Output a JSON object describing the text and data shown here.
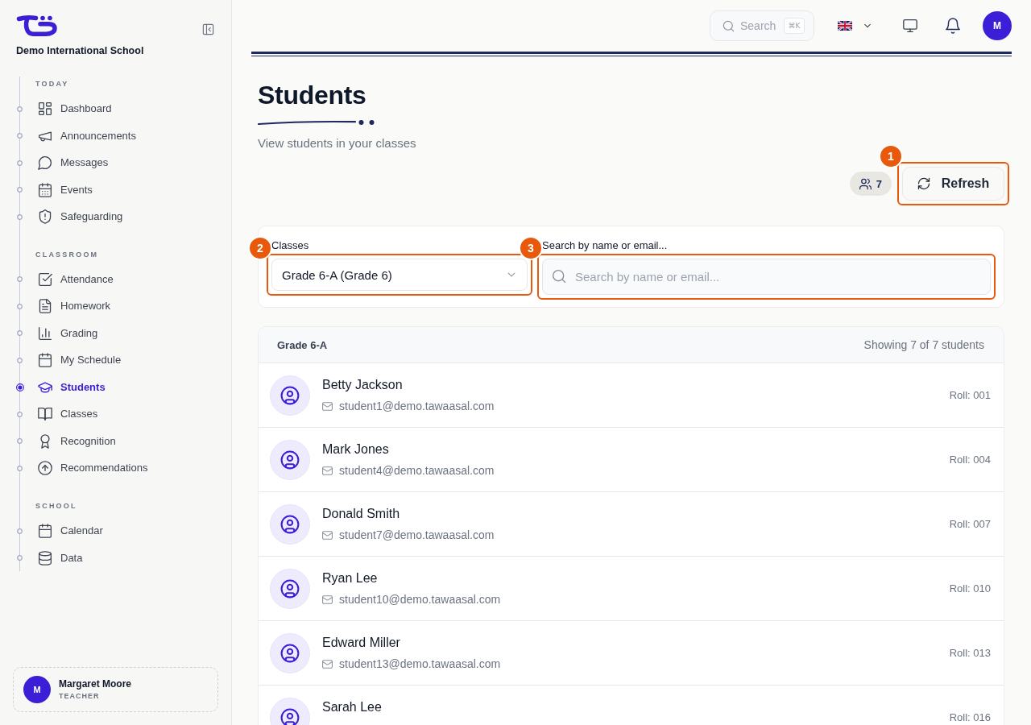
{
  "sidebar": {
    "school_name": "Demo International School",
    "sections": [
      {
        "title": "TODAY",
        "items": [
          {
            "label": "Dashboard",
            "selected": false
          },
          {
            "label": "Announcements",
            "selected": false
          },
          {
            "label": "Messages",
            "selected": false
          },
          {
            "label": "Events",
            "selected": false
          },
          {
            "label": "Safeguarding",
            "selected": false
          }
        ]
      },
      {
        "title": "CLASSROOM",
        "items": [
          {
            "label": "Attendance",
            "selected": false
          },
          {
            "label": "Homework",
            "selected": false
          },
          {
            "label": "Grading",
            "selected": false
          },
          {
            "label": "My Schedule",
            "selected": false
          },
          {
            "label": "Students",
            "selected": true
          },
          {
            "label": "Classes",
            "selected": false
          },
          {
            "label": "Recognition",
            "selected": false
          },
          {
            "label": "Recommendations",
            "selected": false
          }
        ]
      },
      {
        "title": "SCHOOL",
        "items": [
          {
            "label": "Calendar",
            "selected": false
          },
          {
            "label": "Data",
            "selected": false
          }
        ]
      }
    ],
    "user": {
      "initial": "M",
      "name": "Margaret Moore",
      "role": "TEACHER"
    }
  },
  "topbar": {
    "search": {
      "placeholder": "Search",
      "shortcut": "⌘K"
    },
    "avatar_initial": "M"
  },
  "page": {
    "title": "Students",
    "subtitle": "View students in your classes",
    "student_count": "7",
    "refresh_button": {
      "label": "Refresh",
      "callout": "1"
    }
  },
  "filters": {
    "class_select": {
      "label": "Classes",
      "value": "Grade 6-A (Grade 6)",
      "callout": "2"
    },
    "search": {
      "label": "Search by name or email...",
      "placeholder": "Search by name or email...",
      "callout": "3"
    }
  },
  "student_list": {
    "title": "Grade 6-A",
    "summary": "Showing 7 of 7 students",
    "rows": [
      {
        "name": "Betty Jackson",
        "email": "student1@demo.tawaasal.com",
        "roll": "Roll: 001"
      },
      {
        "name": "Mark Jones",
        "email": "student4@demo.tawaasal.com",
        "roll": "Roll: 004"
      },
      {
        "name": "Donald Smith",
        "email": "student7@demo.tawaasal.com",
        "roll": "Roll: 007"
      },
      {
        "name": "Ryan Lee",
        "email": "student10@demo.tawaasal.com",
        "roll": "Roll: 010"
      },
      {
        "name": "Edward Miller",
        "email": "student13@demo.tawaasal.com",
        "roll": "Roll: 013"
      },
      {
        "name": "Sarah Lee",
        "roll": "Roll: 016"
      }
    ]
  }
}
